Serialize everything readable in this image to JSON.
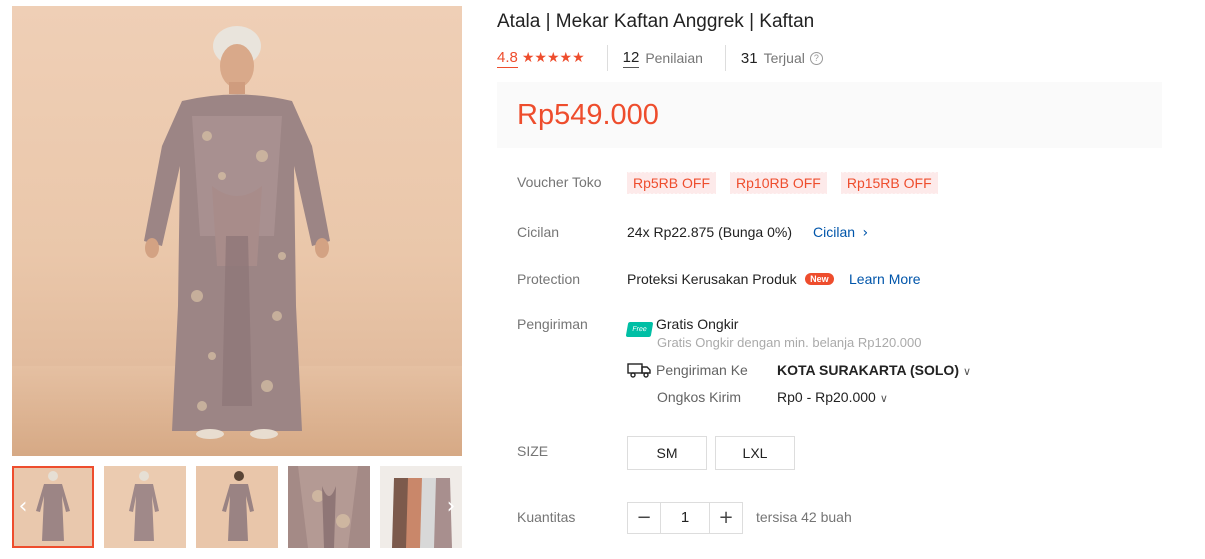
{
  "product": {
    "title": "Atala | Mekar Kaftan Anggrek | Kaftan",
    "rating": "4.8",
    "stars": "★★★★★",
    "reviews_count": "12",
    "reviews_label": "Penilaian",
    "sold_count": "31",
    "sold_label": "Terjual",
    "price": "Rp549.000"
  },
  "gallery": {
    "prev_arrow": "‹",
    "next_arrow": "›",
    "thumbnail_count": 5,
    "active_thumbnail": 1
  },
  "voucher": {
    "label": "Voucher Toko",
    "items": [
      "Rp5RB OFF",
      "Rp10RB OFF",
      "Rp15RB OFF"
    ]
  },
  "installment": {
    "label": "Cicilan",
    "value": "24x Rp22.875 (Bunga 0%)",
    "link": "Cicilan",
    "chevron": "›"
  },
  "protection": {
    "label": "Protection",
    "value": "Proteksi Kerusakan Produk",
    "badge": "New",
    "link": "Learn More"
  },
  "shipping": {
    "label": "Pengiriman",
    "free_badge": "Free",
    "free_title": "Gratis Ongkir",
    "free_desc": "Gratis Ongkir dengan min. belanja Rp120.000",
    "to_label": "Pengiriman Ke",
    "to_value": "KOTA SURAKARTA (SOLO)",
    "cost_label": "Ongkos Kirim",
    "cost_value": "Rp0 - Rp20.000",
    "chevron": "∨"
  },
  "size": {
    "label": "SIZE",
    "options": [
      "SM",
      "LXL"
    ]
  },
  "quantity": {
    "label": "Kuantitas",
    "minus": "−",
    "value": "1",
    "plus": "+",
    "stock": "tersisa 42 buah"
  },
  "colors": {
    "accent": "#ee4d2d",
    "link": "#0055aa",
    "free_shipping": "#00bfa5"
  }
}
